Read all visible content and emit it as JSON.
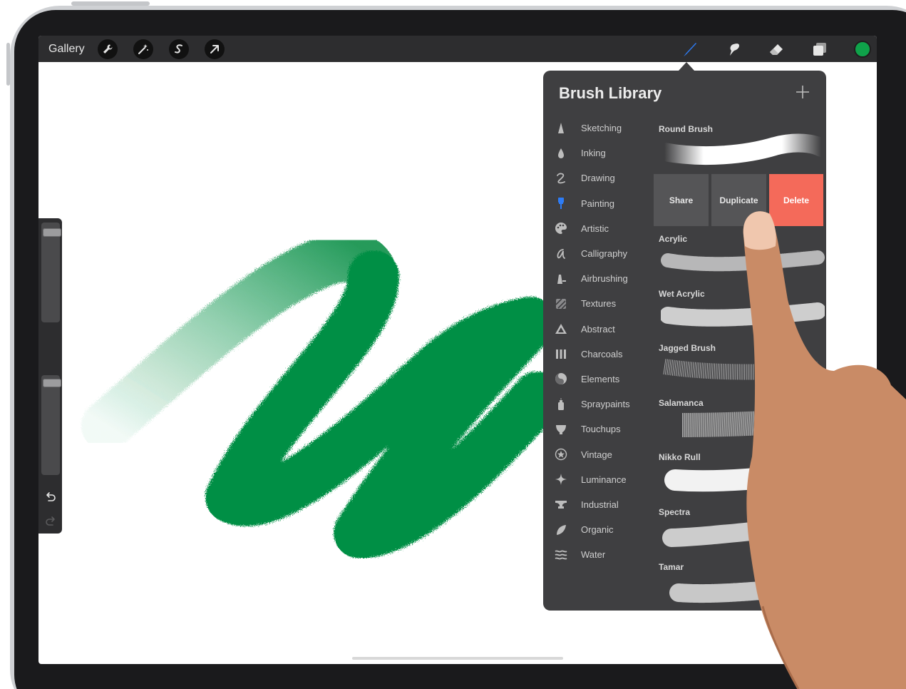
{
  "toolbar": {
    "gallery_label": "Gallery",
    "left_tools": [
      {
        "icon": "wrench-icon"
      },
      {
        "icon": "magic-wand-icon"
      },
      {
        "icon": "selection-icon"
      },
      {
        "icon": "transform-arrow-icon"
      }
    ],
    "right_tools": [
      {
        "icon": "brush-icon",
        "active": true
      },
      {
        "icon": "smudge-icon"
      },
      {
        "icon": "eraser-icon"
      },
      {
        "icon": "layers-icon"
      }
    ],
    "current_color": "#0fa24a"
  },
  "sidebar": {
    "brush_size_level": 0.05,
    "opacity_level": 0.05
  },
  "brush_library": {
    "title": "Brush Library",
    "categories": [
      {
        "label": "Sketching",
        "icon": "pencil-tip-icon"
      },
      {
        "label": "Inking",
        "icon": "ink-drop-icon"
      },
      {
        "label": "Drawing",
        "icon": "squiggle-icon"
      },
      {
        "label": "Painting",
        "icon": "paint-brush-icon",
        "active": true
      },
      {
        "label": "Artistic",
        "icon": "palette-icon"
      },
      {
        "label": "Calligraphy",
        "icon": "calligraphy-icon"
      },
      {
        "label": "Airbrushing",
        "icon": "airbrush-icon"
      },
      {
        "label": "Textures",
        "icon": "texture-icon"
      },
      {
        "label": "Abstract",
        "icon": "triangle-icon"
      },
      {
        "label": "Charcoals",
        "icon": "charcoal-icon"
      },
      {
        "label": "Elements",
        "icon": "yin-yang-icon"
      },
      {
        "label": "Spraypaints",
        "icon": "spray-can-icon"
      },
      {
        "label": "Touchups",
        "icon": "touchup-icon"
      },
      {
        "label": "Vintage",
        "icon": "star-badge-icon"
      },
      {
        "label": "Luminance",
        "icon": "sparkle-icon"
      },
      {
        "label": "Industrial",
        "icon": "anvil-icon"
      },
      {
        "label": "Organic",
        "icon": "leaf-icon"
      },
      {
        "label": "Water",
        "icon": "waves-icon"
      }
    ],
    "brushes": [
      {
        "name": "Round Brush"
      },
      {
        "name": "Acrylic"
      },
      {
        "name": "Wet Acrylic"
      },
      {
        "name": "Jagged Brush"
      },
      {
        "name": "Salamanca"
      },
      {
        "name": "Nikko Rull"
      },
      {
        "name": "Spectra"
      },
      {
        "name": "Tamar"
      }
    ],
    "swipe_actions": {
      "share": "Share",
      "duplicate": "Duplicate",
      "delete": "Delete"
    },
    "delete_color": "#f46a5a"
  }
}
